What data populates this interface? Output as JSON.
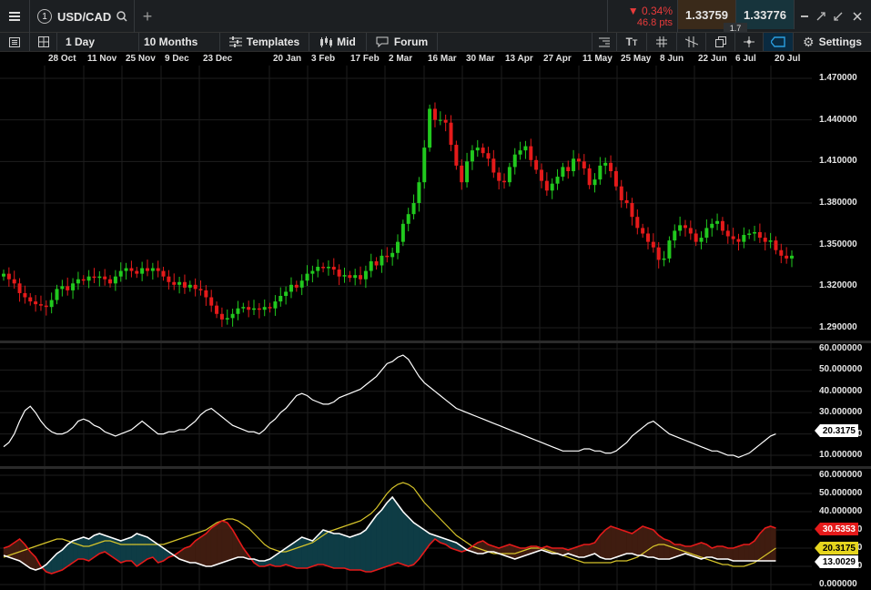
{
  "toolbar": {
    "menu_icon": "hamburger-icon",
    "badge": "1",
    "symbol": "USD/CAD",
    "add_tab": "+",
    "change_pct": "0.34%",
    "change_pts": "46.8 pts",
    "bid": "1.33759",
    "ask": "1.33776",
    "spread": "1.7",
    "interval": "1 Day",
    "range": "10 Months",
    "templates": "Templates",
    "price_type": "Mid",
    "forum": "Forum",
    "settings": "Settings"
  },
  "colors": {
    "up": "#21c91e",
    "down": "#e51a1a",
    "line_white": "#ffffff",
    "line_yellow": "#d6c42a",
    "fill_teal": "#0e3c45",
    "fill_brown": "#3f1c10"
  },
  "x_axis_dates": [
    "28 Oct",
    "11 Nov",
    "25 Nov",
    "9 Dec",
    "23 Dec",
    "20 Jan",
    "3 Feb",
    "17 Feb",
    "2 Mar",
    "16 Mar",
    "30 Mar",
    "13 Apr",
    "27 Apr",
    "11 May",
    "25 May",
    "8 Jun",
    "22 Jun",
    "6 Jul",
    "20 Jul"
  ],
  "price_axis": [
    "1.470000",
    "1.440000",
    "1.410000",
    "1.380000",
    "1.350000",
    "1.320000",
    "1.290000"
  ],
  "indicator1_axis": [
    "60.000000",
    "50.000000",
    "40.000000",
    "30.000000",
    "20.000000",
    "10.000000"
  ],
  "indicator1_tag": "20.3175",
  "indicator2_axis": [
    "60.000000",
    "50.000000",
    "40.000000",
    "30.000000",
    "20.000000",
    "10.000000",
    "0.000000"
  ],
  "indicator2_tags": [
    "30.5353",
    "20.3175",
    "13.0029"
  ],
  "chart_data": {
    "type": "candlestick",
    "series_price_close": [
      1.329,
      1.325,
      1.322,
      1.315,
      1.312,
      1.309,
      1.307,
      1.306,
      1.305,
      1.31,
      1.318,
      1.32,
      1.317,
      1.322,
      1.325,
      1.324,
      1.327,
      1.326,
      1.327,
      1.325,
      1.322,
      1.327,
      1.331,
      1.333,
      1.331,
      1.329,
      1.333,
      1.331,
      1.333,
      1.331,
      1.327,
      1.323,
      1.321,
      1.323,
      1.319,
      1.321,
      1.318,
      1.317,
      1.312,
      1.306,
      1.3,
      1.296,
      1.297,
      1.3,
      1.304,
      1.305,
      1.303,
      1.304,
      1.303,
      1.305,
      1.304,
      1.309,
      1.313,
      1.316,
      1.321,
      1.319,
      1.324,
      1.329,
      1.331,
      1.334,
      1.333,
      1.334,
      1.332,
      1.327,
      1.328,
      1.326,
      1.328,
      1.325,
      1.331,
      1.338,
      1.335,
      1.342,
      1.341,
      1.344,
      1.352,
      1.365,
      1.372,
      1.38,
      1.395,
      1.42,
      1.448,
      1.44,
      1.44,
      1.438,
      1.422,
      1.407,
      1.395,
      1.41,
      1.418,
      1.42,
      1.416,
      1.412,
      1.402,
      1.396,
      1.395,
      1.406,
      1.415,
      1.418,
      1.421,
      1.411,
      1.404,
      1.396,
      1.389,
      1.394,
      1.399,
      1.406,
      1.403,
      1.412,
      1.41,
      1.405,
      1.393,
      1.397,
      1.407,
      1.409,
      1.403,
      1.392,
      1.382,
      1.38,
      1.37,
      1.362,
      1.358,
      1.352,
      1.348,
      1.339,
      1.34,
      1.353,
      1.36,
      1.364,
      1.362,
      1.358,
      1.352,
      1.355,
      1.362,
      1.365,
      1.367,
      1.36,
      1.356,
      1.354,
      1.352,
      1.357,
      1.358,
      1.359,
      1.355,
      1.352,
      1.353,
      1.346,
      1.342,
      1.34,
      1.342
    ],
    "indicator1_values": [
      14,
      16,
      20,
      26,
      31,
      33,
      30,
      26,
      23,
      21,
      20,
      20,
      21,
      23,
      26,
      27,
      26,
      24,
      23,
      21,
      20,
      19,
      20,
      21,
      22,
      24,
      26,
      24,
      22,
      20,
      20,
      21,
      21,
      22,
      22,
      24,
      26,
      29,
      31,
      32,
      30,
      28,
      26,
      24,
      23,
      22,
      21,
      21,
      20,
      22,
      25,
      27,
      30,
      32,
      35,
      38,
      39,
      38,
      36,
      35,
      34,
      34,
      35,
      37,
      38,
      39,
      40,
      41,
      43,
      45,
      47,
      50,
      53,
      54,
      56,
      57,
      55,
      51,
      47,
      44,
      42,
      40,
      38,
      36,
      34,
      32,
      31,
      30,
      29,
      28,
      27,
      26,
      25,
      24,
      23,
      22,
      21,
      20,
      19,
      18,
      17,
      16,
      15,
      14,
      13,
      12,
      12,
      12,
      12,
      13,
      13,
      12,
      12,
      11,
      11,
      12,
      14,
      16,
      19,
      21,
      23,
      25,
      26,
      24,
      22,
      20,
      19,
      18,
      17,
      16,
      15,
      14,
      13,
      12,
      12,
      11,
      10,
      10,
      9,
      10,
      11,
      13,
      15,
      17,
      19,
      20
    ],
    "indicator2_red": [
      20,
      21,
      23,
      25,
      22,
      18,
      15,
      10,
      7,
      6,
      7,
      8,
      10,
      12,
      14,
      14,
      13,
      15,
      17,
      18,
      16,
      14,
      12,
      13,
      13,
      10,
      12,
      14,
      15,
      12,
      13,
      15,
      16,
      18,
      20,
      21,
      24,
      26,
      28,
      31,
      33,
      35,
      34,
      30,
      25,
      20,
      16,
      12,
      10,
      10,
      11,
      10,
      10,
      11,
      10,
      9,
      9,
      9,
      10,
      11,
      11,
      10,
      9,
      9,
      9,
      8,
      8,
      8,
      7,
      7,
      8,
      9,
      10,
      11,
      12,
      11,
      10,
      11,
      14,
      18,
      22,
      25,
      23,
      22,
      20,
      19,
      18,
      19,
      21,
      23,
      24,
      22,
      21,
      20,
      21,
      22,
      21,
      20,
      20,
      21,
      21,
      20,
      21,
      20,
      20,
      20,
      19,
      20,
      21,
      22,
      22,
      23,
      27,
      30,
      32,
      31,
      30,
      29,
      28,
      30,
      32,
      31,
      30,
      27,
      25,
      24,
      22,
      22,
      21,
      21,
      22,
      23,
      22,
      20,
      21,
      21,
      20,
      20,
      21,
      22,
      22,
      24,
      28,
      31,
      32,
      31
    ],
    "indicator2_white": [
      16,
      15,
      14,
      13,
      11,
      9,
      8,
      9,
      11,
      14,
      17,
      19,
      22,
      24,
      25,
      26,
      25,
      27,
      28,
      27,
      26,
      25,
      24,
      25,
      26,
      28,
      27,
      26,
      24,
      22,
      20,
      18,
      16,
      14,
      13,
      12,
      12,
      11,
      10,
      10,
      11,
      12,
      13,
      14,
      15,
      15,
      14,
      14,
      13,
      13,
      14,
      16,
      18,
      20,
      22,
      24,
      26,
      25,
      24,
      27,
      30,
      29,
      28,
      28,
      27,
      26,
      27,
      28,
      30,
      34,
      38,
      41,
      45,
      48,
      44,
      40,
      37,
      34,
      32,
      30,
      28,
      27,
      26,
      25,
      24,
      23,
      21,
      19,
      18,
      17,
      17,
      18,
      18,
      17,
      16,
      15,
      14,
      15,
      16,
      17,
      18,
      19,
      18,
      17,
      17,
      16,
      17,
      16,
      15,
      15,
      16,
      17,
      15,
      14,
      14,
      15,
      16,
      17,
      17,
      16,
      16,
      15,
      15,
      14,
      14,
      14,
      15,
      16,
      17,
      16,
      15,
      14,
      15,
      15,
      14,
      14,
      14,
      13,
      13,
      13,
      13,
      13,
      13,
      13,
      13,
      13
    ],
    "indicator2_yellow": [
      15,
      16,
      17,
      18,
      19,
      20,
      21,
      22,
      23,
      24,
      25,
      25,
      24,
      23,
      22,
      21,
      21,
      22,
      23,
      24,
      24,
      23,
      22,
      22,
      22,
      22,
      22,
      22,
      22,
      22,
      22,
      23,
      24,
      25,
      26,
      27,
      28,
      29,
      30,
      32,
      34,
      35,
      36,
      36,
      35,
      33,
      31,
      28,
      25,
      22,
      20,
      19,
      18,
      18,
      19,
      20,
      21,
      22,
      23,
      25,
      27,
      29,
      30,
      31,
      32,
      33,
      34,
      35,
      37,
      39,
      42,
      46,
      50,
      53,
      55,
      56,
      55,
      53,
      49,
      45,
      42,
      39,
      36,
      33,
      30,
      27,
      25,
      23,
      21,
      20,
      19,
      18,
      17,
      17,
      17,
      17,
      17,
      18,
      19,
      20,
      20,
      20,
      19,
      18,
      17,
      16,
      15,
      14,
      13,
      12,
      12,
      12,
      12,
      12,
      12,
      13,
      13,
      13,
      14,
      15,
      17,
      19,
      21,
      22,
      22,
      21,
      20,
      19,
      18,
      17,
      16,
      15,
      14,
      13,
      12,
      11,
      11,
      10,
      10,
      10,
      11,
      12,
      14,
      16,
      18,
      20
    ]
  }
}
